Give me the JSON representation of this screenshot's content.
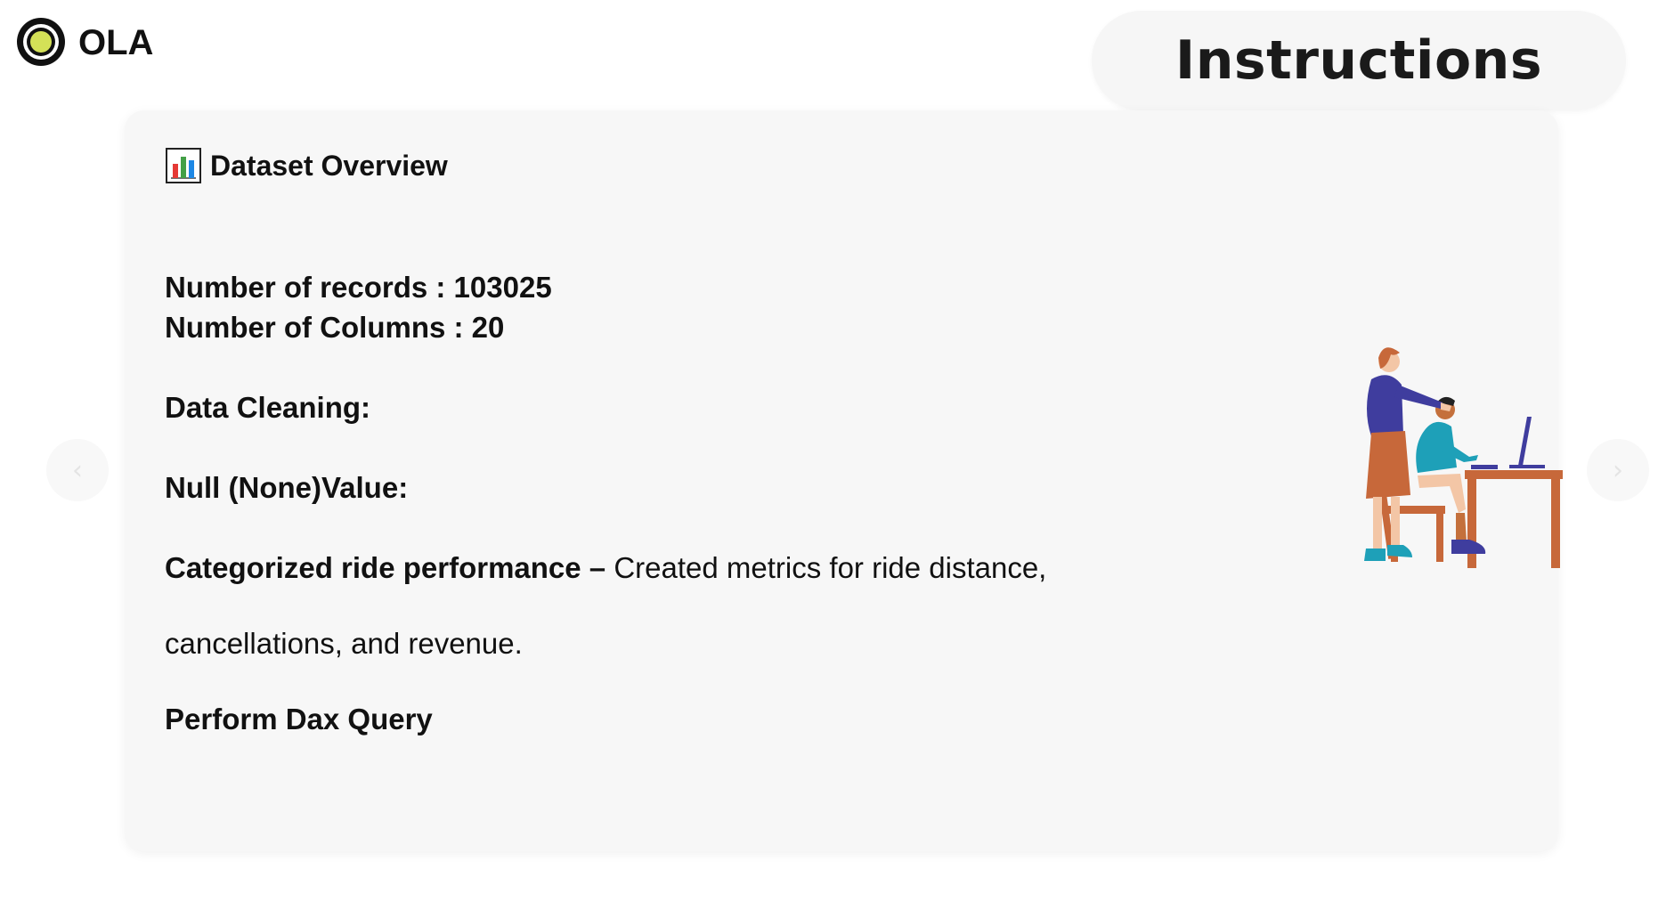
{
  "logo": {
    "text": "OLA",
    "icon": "ola-logo-icon"
  },
  "title": "Instructions",
  "card": {
    "heading_icon": "bar-chart-icon",
    "heading": "Dataset Overview",
    "records_line": "Number of records : 103025",
    "columns_line": "Number of Columns : 20",
    "data_cleaning": "Data Cleaning:",
    "null_value": "Null (None)Value:",
    "perf_label": "Categorized ride performance –",
    "perf_desc": " Created metrics for ride distance,",
    "perf_cont": "cancellations, and revenue.",
    "dax": "Perform Dax Query"
  },
  "nav": {
    "prev_icon": "chevron-left-icon",
    "prev_glyph": "‹",
    "next_icon": "chevron-right-icon",
    "next_glyph": "›"
  },
  "colors": {
    "logo_yellow": "#d4e157",
    "logo_dark": "#111111",
    "card_bg": "#f7f7f7",
    "pill_bg": "#f6f6f6"
  }
}
